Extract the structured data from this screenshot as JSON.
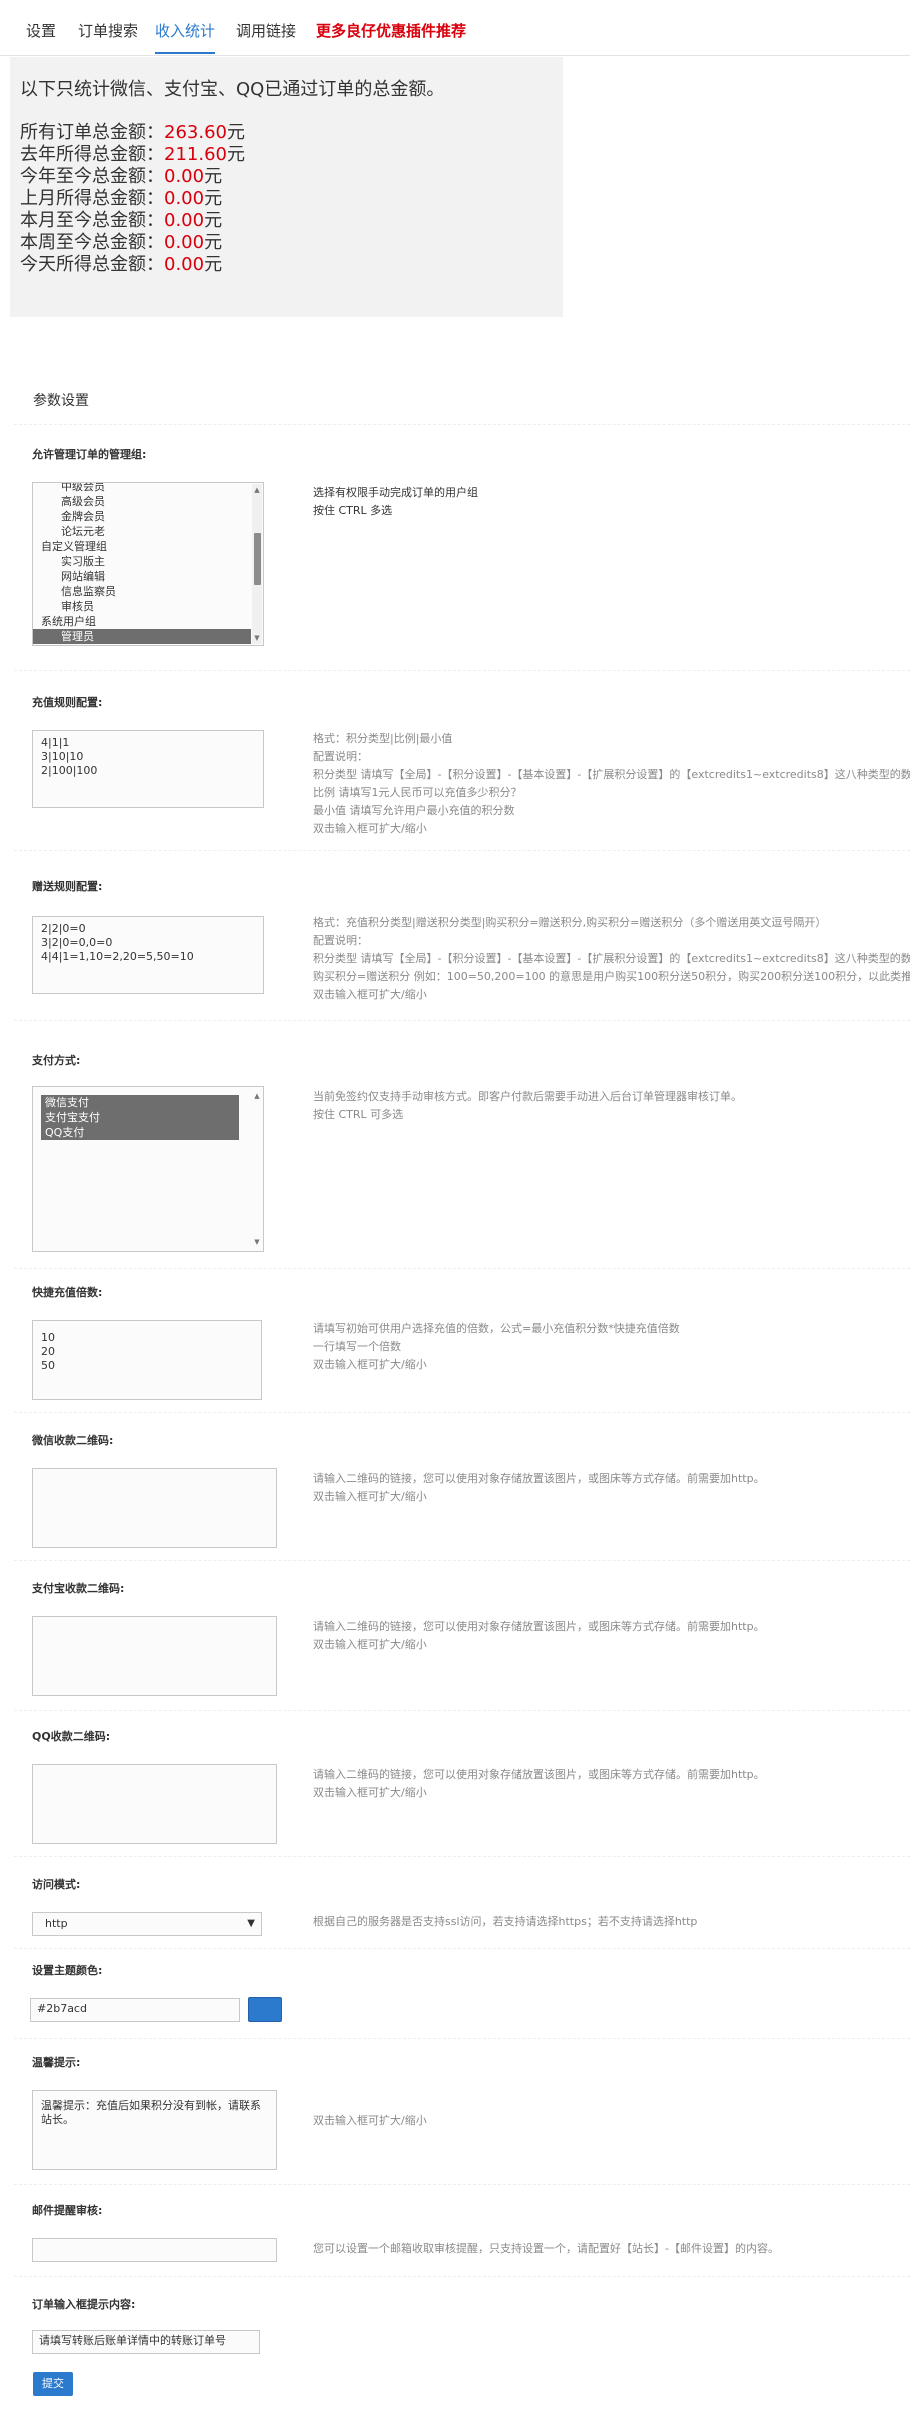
{
  "tabs": [
    {
      "label": "设置"
    },
    {
      "label": "订单搜索"
    },
    {
      "label": "收入统计"
    },
    {
      "label": "调用链接"
    },
    {
      "label": "更多良仔优惠插件推荐"
    }
  ],
  "stats": {
    "intro": "以下只统计微信、支付宝、QQ已通过订单的总金额。",
    "unit": "元",
    "rows": [
      {
        "label": "所有订单总金额：",
        "value": "263.60"
      },
      {
        "label": "去年所得总金额：",
        "value": "211.60"
      },
      {
        "label": "今年至今总金额：",
        "value": "0.00"
      },
      {
        "label": "上月所得总金额：",
        "value": "0.00"
      },
      {
        "label": "本月至今总金额：",
        "value": "0.00"
      },
      {
        "label": "本周至今总金额：",
        "value": "0.00"
      },
      {
        "label": "今天所得总金额：",
        "value": "0.00"
      }
    ]
  },
  "settings": {
    "title": "参数设置",
    "submit": "提交",
    "fields": {
      "manager_groups": {
        "label": "允许管理订单的管理组:",
        "desc": "选择有权限手动完成订单的用户组\n按住 CTRL 多选",
        "options": [
          {
            "text": "中级会员",
            "indent": true,
            "selected": false
          },
          {
            "text": "高级会员",
            "indent": true,
            "selected": false
          },
          {
            "text": "金牌会员",
            "indent": true,
            "selected": false
          },
          {
            "text": "论坛元老",
            "indent": true,
            "selected": false
          },
          {
            "text": "自定义管理组",
            "indent": false,
            "selected": false
          },
          {
            "text": "实习版主",
            "indent": true,
            "selected": false
          },
          {
            "text": "网站编辑",
            "indent": true,
            "selected": false
          },
          {
            "text": "信息监察员",
            "indent": true,
            "selected": false
          },
          {
            "text": "审核员",
            "indent": true,
            "selected": false
          },
          {
            "text": "系统用户组",
            "indent": false,
            "selected": false
          },
          {
            "text": "管理员",
            "indent": true,
            "selected": true
          }
        ]
      },
      "recharge_rules": {
        "label": "充值规则配置:",
        "value": "4|1|1\n3|10|10\n2|100|100",
        "desc": "格式：积分类型|比例|最小值\n配置说明：\n积分类型 请填写【全局】-【积分设置】-【基本设置】-【扩展积分设置】的【extcredits1~extcredits8】这八种类型的数字\n比例 请填写1元人民币可以充值多少积分？\n最小值 请填写允许用户最小充值的积分数\n双击输入框可扩大/缩小"
      },
      "gift_rules": {
        "label": "赠送规则配置:",
        "value": "2|2|0=0\n3|2|0=0,0=0\n4|4|1=1,10=2,20=5,50=10",
        "desc": "格式：充值积分类型|赠送积分类型|购买积分=赠送积分,购买积分=赠送积分（多个赠送用英文逗号隔开）\n配置说明：\n积分类型 请填写【全局】-【积分设置】-【基本设置】-【扩展积分设置】的【extcredits1~extcredits8】这八种类型的数字\n购买积分=赠送积分 例如：100=50,200=100 的意思是用户购买100积分送50积分，购买200积分送100积分，以此类推\n双击输入框可扩大/缩小"
      },
      "payment": {
        "label": "支付方式:",
        "desc": "当前免签约仅支持手动审核方式。即客户付款后需要手动进入后台订单管理器审核订单。\n按住 CTRL 可多选",
        "options": [
          {
            "text": "微信支付",
            "selected": true
          },
          {
            "text": "支付宝支付",
            "selected": true
          },
          {
            "text": "QQ支付",
            "selected": true
          }
        ]
      },
      "quick_multiples": {
        "label": "快捷充值倍数:",
        "value": "10\n20\n50",
        "desc": "请填写初始可供用户选择充值的倍数，公式=最小充值积分数*快捷充值倍数\n一行填写一个倍数\n双击输入框可扩大/缩小"
      },
      "wechat_qr": {
        "label": "微信收款二维码:",
        "value": "",
        "desc": "请输入二维码的链接，您可以使用对象存储放置该图片，或图床等方式存储。前需要加http。\n双击输入框可扩大/缩小"
      },
      "alipay_qr": {
        "label": "支付宝收款二维码:",
        "value": "",
        "desc": "请输入二维码的链接，您可以使用对象存储放置该图片，或图床等方式存储。前需要加http。\n双击输入框可扩大/缩小"
      },
      "qq_qr": {
        "label": "QQ收款二维码:",
        "value": "",
        "desc": "请输入二维码的链接，您可以使用对象存储放置该图片，或图床等方式存储。前需要加http。\n双击输入框可扩大/缩小"
      },
      "access_mode": {
        "label": "访问模式:",
        "value": "http",
        "desc": "根据自己的服务器是否支持ssl访问，若支持请选择https；若不支持请选择http"
      },
      "theme_color": {
        "label": "设置主题颜色:",
        "value": "#2b7acd",
        "swatch": "#2b7acd"
      },
      "tips": {
        "label": "温馨提示:",
        "value": "温馨提示：充值后如果积分没有到帐，请联系\n站长。",
        "desc": "双击输入框可扩大/缩小"
      },
      "mail_review": {
        "label": "邮件提醒审核:",
        "value": "",
        "desc": "您可以设置一个邮箱收取审核提醒，只支持设置一个，请配置好【站长】-【邮件设置】的内容。"
      },
      "order_hint": {
        "label": "订单输入框提示内容:",
        "value": "请填写转账后账单详情中的转账订单号"
      }
    }
  }
}
